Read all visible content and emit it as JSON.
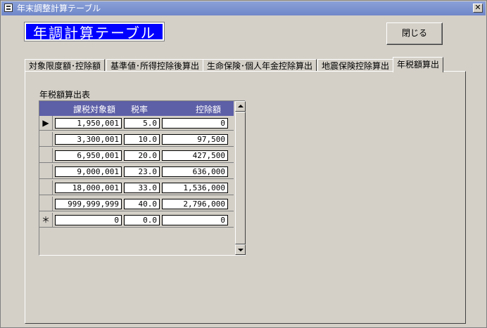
{
  "window": {
    "title": "年末調整計算テーブル",
    "close_glyph": "✕"
  },
  "header": {
    "title": "年調計算テーブル",
    "close_button": "閉じる"
  },
  "tabs": [
    {
      "label": "対象限度額･控除額",
      "active": false
    },
    {
      "label": "基準値･所得控除後算出",
      "active": false
    },
    {
      "label": "生命保険･個人年金控除算出",
      "active": false
    },
    {
      "label": "地震保険控除算出",
      "active": false
    },
    {
      "label": "年税額算出",
      "active": true
    }
  ],
  "table": {
    "label": "年税額算出表",
    "columns": [
      "課税対象額",
      "税率",
      "控除額"
    ],
    "current_marker": "▶",
    "new_marker": "＊",
    "rows": [
      {
        "amount": "1,950,001",
        "rate": "5.0",
        "deduction": "0"
      },
      {
        "amount": "3,300,001",
        "rate": "10.0",
        "deduction": "97,500"
      },
      {
        "amount": "6,950,001",
        "rate": "20.0",
        "deduction": "427,500"
      },
      {
        "amount": "9,000,001",
        "rate": "23.0",
        "deduction": "636,000"
      },
      {
        "amount": "18,000,001",
        "rate": "33.0",
        "deduction": "1,536,000"
      },
      {
        "amount": "999,999,999",
        "rate": "40.0",
        "deduction": "2,796,000"
      },
      {
        "amount": "0",
        "rate": "0.0",
        "deduction": "0"
      }
    ]
  },
  "colors": {
    "title_bg": "#0000ff",
    "grid_header_bg": "#5d5fa7",
    "window_bg": "#d4d0c8"
  },
  "icons": {
    "app": "app-window-icon",
    "close": "close-icon",
    "scroll_up": "arrow-up-icon",
    "scroll_down": "arrow-down-icon"
  }
}
